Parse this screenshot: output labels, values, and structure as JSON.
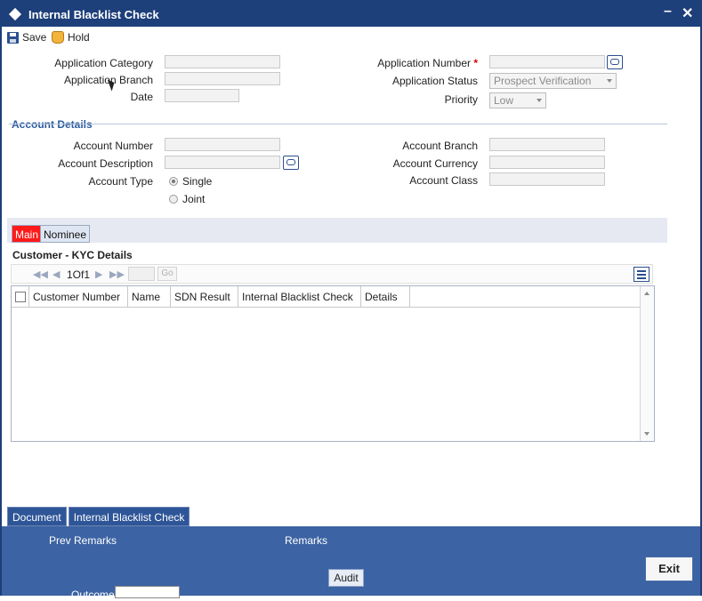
{
  "window": {
    "title": "Internal Blacklist Check",
    "minimize_icon": "minimize-icon",
    "close_icon": "close-icon"
  },
  "toolbar": {
    "save_label": "Save",
    "hold_label": "Hold"
  },
  "application": {
    "category_label": "Application Category",
    "branch_label": "Application Branch",
    "date_label": "Date",
    "number_label": "Application Number",
    "required_mark": "*",
    "status_label": "Application Status",
    "status_value": "Prospect Verification",
    "priority_label": "Priority",
    "priority_value": "Low"
  },
  "account": {
    "section_title": "Account Details",
    "number_label": "Account Number",
    "description_label": "Account Description",
    "type_label": "Account Type",
    "type_single": "Single",
    "type_joint": "Joint",
    "branch_label": "Account Branch",
    "currency_label": "Account Currency",
    "class_label": "Account Class"
  },
  "tabs": {
    "main": "Main",
    "nominee": "Nominee"
  },
  "kyc": {
    "title": "Customer - KYC Details",
    "pager_text": "1Of1",
    "go_label": "Go",
    "columns": [
      "Customer Number",
      "Name",
      "SDN Result",
      "Internal Blacklist Check",
      "Details"
    ]
  },
  "subtabs": {
    "document": "Document",
    "internal_blacklist": "Internal Blacklist Check"
  },
  "footer": {
    "prev_remarks": "Prev Remarks",
    "remarks": "Remarks",
    "audit": "Audit",
    "exit": "Exit",
    "outcome_label": "Outcome"
  },
  "colors": {
    "title_bar": "#1d3f7a",
    "accent": "#2a5a9f",
    "footer": "#3c63a3",
    "main_tab": "#ff1a1a"
  }
}
